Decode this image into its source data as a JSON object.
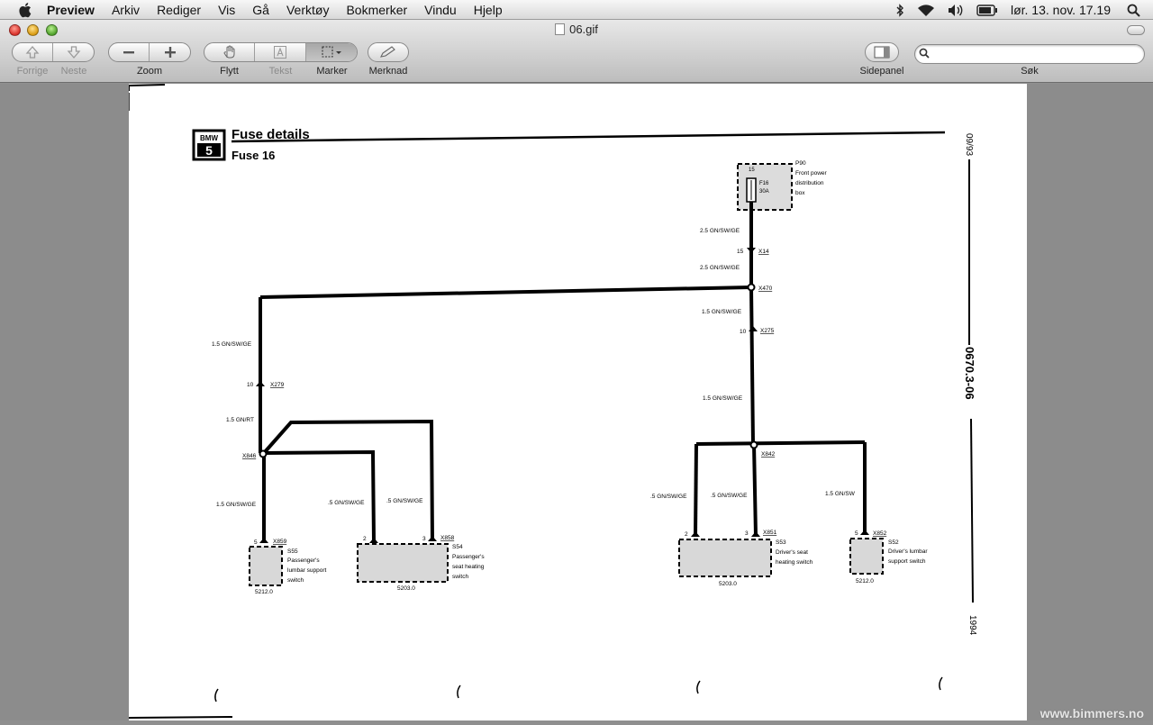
{
  "menubar": {
    "app_name": "Preview",
    "items": [
      "Arkiv",
      "Rediger",
      "Vis",
      "Gå",
      "Verktøy",
      "Bokmerker",
      "Vindu",
      "Hjelp"
    ],
    "clock": "lør. 13. nov.  17.19"
  },
  "window": {
    "title": "06.gif"
  },
  "toolbar": {
    "back_label": "Forrige",
    "forward_label": "Neste",
    "zoom_label": "Zoom",
    "move_label": "Flytt",
    "text_label": "Tekst",
    "select_label": "Marker",
    "annotate_label": "Merknad",
    "sidebar_label": "Sidepanel",
    "search_label": "Søk",
    "search_value": "",
    "search_placeholder": ""
  },
  "diagram": {
    "logo": "BMW 5",
    "title": "Fuse details",
    "subtitle": "Fuse 16",
    "side_date": "09/93",
    "side_code": "0670.3-06",
    "side_year": "1994",
    "fuse_box": {
      "id": "P90",
      "pin": "15",
      "fuse": "F16",
      "rating": "30A",
      "description": [
        "Front power",
        "distribution",
        "box"
      ]
    },
    "wires": [
      "2.5 GN/SW/GE",
      "2.5 GN/SW/GE",
      "1.5 GN/SW/GE",
      "1.5 GN/SW/GE",
      "1.5 GN/SW/GE",
      "1.5 GN/RT",
      "1.5 GN/SW/GE",
      ".5 GN/SW/GE",
      ".5 GN/SW/GE",
      ".5 GN/SW/GE",
      ".5 GN/SW/GE",
      "1.5 GN/SW"
    ],
    "connectors": {
      "x14": "X14",
      "x14_pin": "15",
      "x470": "X470",
      "x275": "X275",
      "x275_pin": "10",
      "x279": "X279",
      "x279_pin": "10",
      "x846": "X846",
      "x842": "X842",
      "x859": "X859",
      "x859_pin": "5",
      "x858": "X858",
      "x858_pin_a": "2",
      "x858_pin_b": "3",
      "x851": "X851",
      "x851_pin_a": "2",
      "x851_pin_b": "3",
      "x852": "X852",
      "x852_pin": "5"
    },
    "components": [
      {
        "id": "S55",
        "desc": [
          "Passenger's",
          "lumbar support",
          "switch"
        ],
        "ref": "5212.0"
      },
      {
        "id": "S54",
        "desc": [
          "Passenger's",
          "seat heating",
          "switch"
        ],
        "ref": "5203.0"
      },
      {
        "id": "S53",
        "desc": [
          "Driver's seat",
          "heating switch"
        ],
        "ref": "5203.0"
      },
      {
        "id": "S52",
        "desc": [
          "Driver's lumbar",
          "support switch"
        ],
        "ref": "5212.0"
      }
    ]
  },
  "watermark": "www.bimmers.no"
}
